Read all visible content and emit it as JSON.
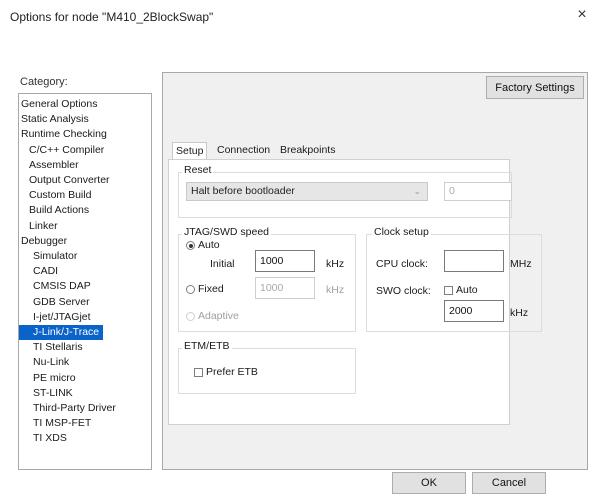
{
  "window": {
    "title": "Options for node \"M410_2BlockSwap\"",
    "close_glyph": "×"
  },
  "category": {
    "label": "Category:",
    "items": [
      "General Options",
      "Static Analysis",
      "Runtime Checking",
      "C/C++ Compiler",
      "Assembler",
      "Output Converter",
      "Custom Build",
      "Build Actions",
      "Linker",
      "Debugger",
      "Simulator",
      "CADI",
      "CMSIS DAP",
      "GDB Server",
      "I-jet/JTAGjet",
      "J-Link/J-Trace",
      "TI Stellaris",
      "Nu-Link",
      "PE micro",
      "ST-LINK",
      "Third-Party Driver",
      "TI MSP-FET",
      "TI XDS"
    ],
    "selected": "J-Link/J-Trace"
  },
  "factory_settings_label": "Factory Settings",
  "tabs": [
    "Setup",
    "Connection",
    "Breakpoints"
  ],
  "active_tab": "Setup",
  "reset": {
    "title": "Reset",
    "select_value": "Halt before bootloader",
    "delay_value": "0"
  },
  "jtag": {
    "title": "JTAG/SWD speed",
    "auto_label": "Auto",
    "initial_label": "Initial",
    "initial_value": "1000",
    "initial_unit": "kHz",
    "fixed_label": "Fixed",
    "fixed_value": "1000",
    "fixed_unit": "kHz",
    "adaptive_label": "Adaptive"
  },
  "clock": {
    "title": "Clock setup",
    "cpu_label": "CPU clock:",
    "cpu_value": "",
    "cpu_unit": "MHz",
    "swo_label": "SWO clock:",
    "swo_auto_label": "Auto",
    "swo_value": "2000",
    "swo_unit": "kHz"
  },
  "etm": {
    "title": "ETM/ETB",
    "prefer_label": "Prefer ETB"
  },
  "buttons": {
    "ok": "OK",
    "cancel": "Cancel"
  }
}
